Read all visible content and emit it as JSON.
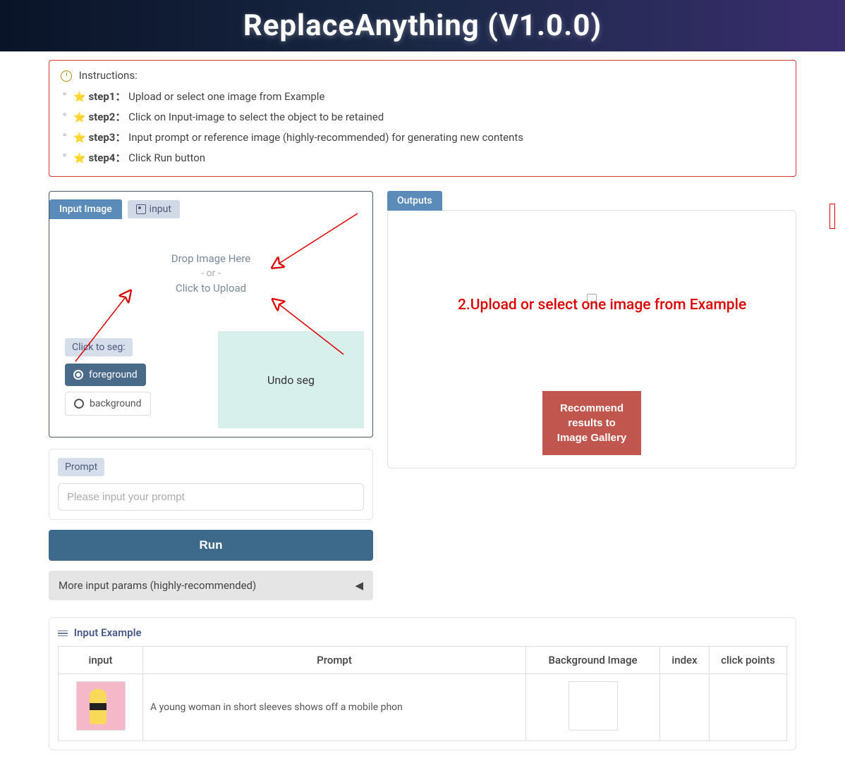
{
  "header": {
    "title": "ReplaceAnything (V1.0.0)"
  },
  "instructions": {
    "title": "Instructions:",
    "steps": [
      {
        "label": "step1：",
        "text": "Upload or select one image from Example"
      },
      {
        "label": "step2：",
        "text": "Click on Input-image to select the object to be retained"
      },
      {
        "label": "step3：",
        "text": "Input prompt or reference image (highly-recommended) for generating new contents"
      },
      {
        "label": "step4：",
        "text": "Click Run button"
      }
    ],
    "toggle": "▼"
  },
  "input_panel": {
    "label": "Input Image",
    "tag": "input",
    "drop1": "Drop Image Here",
    "or": "- or -",
    "drop2": "Click to Upload",
    "seg_label": "Click to seg:",
    "fg": "foreground",
    "bg": "background",
    "undo": "Undo seg"
  },
  "prompt": {
    "tag": "Prompt",
    "placeholder": "Please input your prompt"
  },
  "run_label": "Run",
  "accordion": {
    "label": "More input params (highly-recommended)",
    "arrow": "◀"
  },
  "outputs": {
    "label": "Outputs",
    "recommend": "Recommend results to Image Gallery"
  },
  "overlay": {
    "text": "2.Upload or select one image from Example"
  },
  "example": {
    "title": "Input Example",
    "headers": [
      "input",
      "Prompt",
      "Background Image",
      "index",
      "click points"
    ],
    "row1_prompt": "A young woman in short sleeves shows off a mobile phon"
  }
}
